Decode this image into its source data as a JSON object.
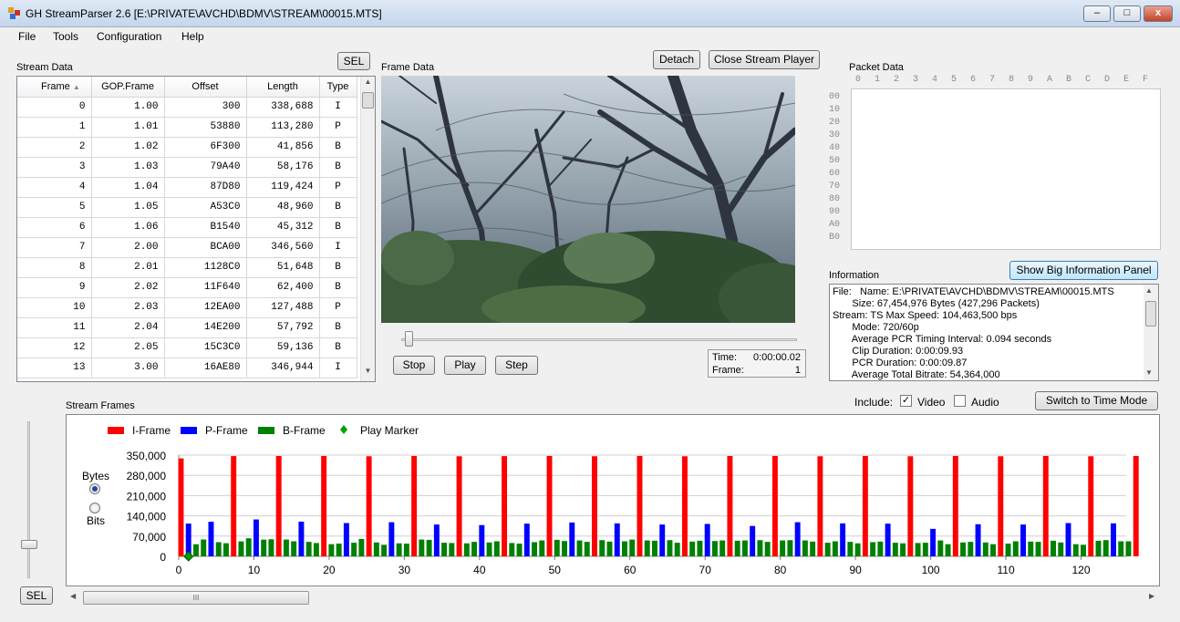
{
  "window": {
    "title": "GH StreamParser 2.6 [E:\\PRIVATE\\AVCHD\\BDMV\\STREAM\\00015.MTS]",
    "close_glyph": "x",
    "minimize_glyph": "–",
    "maximize_glyph": "□"
  },
  "menu": [
    "File",
    "Tools",
    "Configuration",
    "Help"
  ],
  "stream_data": {
    "title": "Stream Data",
    "sel_label": "SEL",
    "columns": [
      "Frame",
      "GOP.Frame",
      "Offset",
      "Length",
      "Type"
    ],
    "rows": [
      [
        "0",
        "1.00",
        "300",
        "338,688",
        "I"
      ],
      [
        "1",
        "1.01",
        "53880",
        "113,280",
        "P"
      ],
      [
        "2",
        "1.02",
        "6F300",
        "41,856",
        "B"
      ],
      [
        "3",
        "1.03",
        "79A40",
        "58,176",
        "B"
      ],
      [
        "4",
        "1.04",
        "87D80",
        "119,424",
        "P"
      ],
      [
        "5",
        "1.05",
        "A53C0",
        "48,960",
        "B"
      ],
      [
        "6",
        "1.06",
        "B1540",
        "45,312",
        "B"
      ],
      [
        "7",
        "2.00",
        "BCA00",
        "346,560",
        "I"
      ],
      [
        "8",
        "2.01",
        "1128C0",
        "51,648",
        "B"
      ],
      [
        "9",
        "2.02",
        "11F640",
        "62,400",
        "B"
      ],
      [
        "10",
        "2.03",
        "12EA00",
        "127,488",
        "P"
      ],
      [
        "11",
        "2.04",
        "14E200",
        "57,792",
        "B"
      ],
      [
        "12",
        "2.05",
        "15C3C0",
        "59,136",
        "B"
      ],
      [
        "13",
        "3.00",
        "16AE80",
        "346,944",
        "I"
      ]
    ]
  },
  "frame_data": {
    "title": "Frame Data",
    "detach_label": "Detach",
    "close_player_label": "Close Stream Player",
    "stop_label": "Stop",
    "play_label": "Play",
    "step_label": "Step",
    "time_label": "Time:",
    "time_value": "0:00:00.02",
    "frame_label": "Frame:",
    "frame_value": "1",
    "seek_position": 0.01
  },
  "packet_data": {
    "title": "Packet Data",
    "col_headers": [
      "0",
      "1",
      "2",
      "3",
      "4",
      "5",
      "6",
      "7",
      "8",
      "9",
      "A",
      "B",
      "C",
      "D",
      "E",
      "F"
    ],
    "row_headers": [
      "00",
      "10",
      "20",
      "30",
      "40",
      "50",
      "60",
      "70",
      "80",
      "90",
      "A0",
      "B0"
    ]
  },
  "information": {
    "title": "Information",
    "big_panel_label": "Show Big Information Panel",
    "lines": [
      "File:   Name: E:\\PRIVATE\\AVCHD\\BDMV\\STREAM\\00015.MTS",
      "       Size: 67,454,976 Bytes (427,296 Packets)",
      "Stream: TS Max Speed: 104,463,500 bps",
      "       Mode: 720/60p",
      "       Average PCR Timing Interval: 0.094 seconds",
      "       Clip Duration: 0:00:09.93",
      "       PCR Duration: 0:00:09.87",
      "       Average Total Bitrate: 54,364,000"
    ]
  },
  "stream_frames": {
    "title": "Stream Frames",
    "include_label": "Include:",
    "video_label": "Video",
    "video_checked": "✓",
    "audio_label": "Audio",
    "switch_label": "Switch to Time Mode",
    "bytes_label": "Bytes",
    "bits_label": "Bits",
    "sel_label": "SEL",
    "scroll_grip": "III"
  },
  "chart_data": {
    "type": "bar",
    "legend": [
      {
        "name": "I-Frame",
        "color": "#ff0000"
      },
      {
        "name": "P-Frame",
        "color": "#0000ff"
      },
      {
        "name": "B-Frame",
        "color": "#008000"
      },
      {
        "name": "Play Marker",
        "color": "#00a000"
      }
    ],
    "ylim": [
      0,
      350000
    ],
    "yticks": [
      "350,000",
      "280,000",
      "210,000",
      "140,000",
      "70,000",
      "0"
    ],
    "ytick_values": [
      350000,
      280000,
      210000,
      140000,
      70000,
      0
    ],
    "xlim": [
      0,
      126
    ],
    "xticks": [
      0,
      10,
      20,
      30,
      40,
      50,
      60,
      70,
      80,
      90,
      100,
      110,
      120
    ],
    "play_marker_frame": 1,
    "frame_types": "IPBBPBBIBBPBBIBBPBBIBBPBBIBBPBBIBBPBBIBBPBBIBBPBBIBBPBBIBBPBBIBBPBBIBBPBBIBBPBBIBBPBBIBBPBBIBBPBBIBBPBBIBBPBBIBBPBBIBBPBBIBBPBBI",
    "values": [
      338688,
      113280,
      41856,
      58176,
      119424,
      48960,
      45312,
      346560,
      51648,
      62400,
      127488,
      57792,
      59136,
      346944,
      58000,
      52000,
      120000,
      50000,
      46000,
      347000,
      42000,
      44000,
      115000,
      47000,
      60000,
      346000,
      48000,
      40000,
      118000,
      45000,
      44000,
      347000,
      58000,
      57000,
      110000,
      47000,
      46000,
      346000,
      45000,
      50000,
      108000,
      48000,
      52000,
      346500,
      46000,
      44000,
      113000,
      49000,
      55000,
      347000,
      57000,
      53000,
      117000,
      55000,
      50000,
      346000,
      56000,
      51000,
      114000,
      52000,
      58000,
      347000,
      55000,
      54000,
      110000,
      56000,
      47000,
      346000,
      51000,
      54000,
      112000,
      53000,
      55000,
      346800,
      54000,
      55000,
      105000,
      56000,
      50000,
      347000,
      55000,
      56000,
      118000,
      55000,
      51000,
      346000,
      47000,
      52000,
      114000,
      50000,
      45000,
      346900,
      49000,
      51000,
      113000,
      47000,
      45000,
      346000,
      46000,
      47000,
      95000,
      55000,
      42000,
      347000,
      48000,
      50000,
      111000,
      48000,
      42000,
      346000,
      44000,
      52000,
      110000,
      51000,
      50000,
      347000,
      54000,
      48000,
      115000,
      42000,
      40000,
      346000,
      54000,
      56000,
      114000,
      52000,
      52000,
      347000
    ]
  }
}
